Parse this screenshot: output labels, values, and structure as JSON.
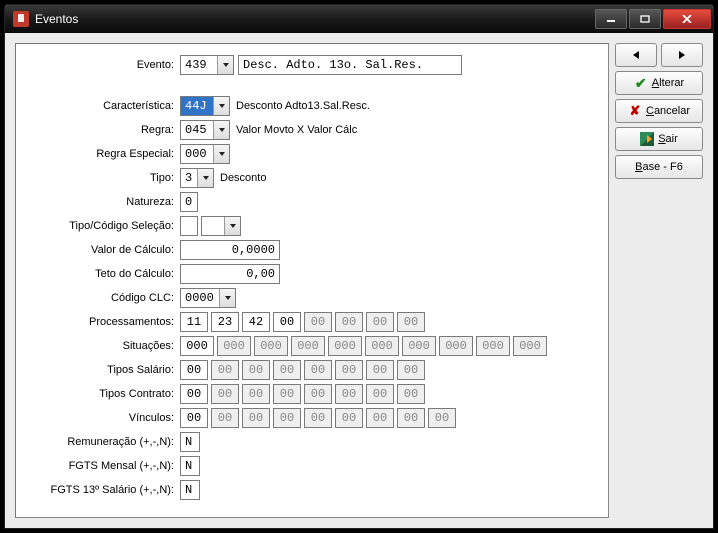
{
  "window": {
    "title": "Eventos"
  },
  "side": {
    "alterar": "Alterar",
    "cancelar": "Cancelar",
    "sair": "Sair",
    "base": "Base - F6"
  },
  "labels": {
    "evento": "Evento:",
    "caracteristica": "Característica:",
    "regra": "Regra:",
    "regra_especial": "Regra Especial:",
    "tipo": "Tipo:",
    "natureza": "Natureza:",
    "tipo_codigo_selecao": "Tipo/Código Seleção:",
    "valor_calculo": "Valor de Cálculo:",
    "teto_calculo": "Teto do Cálculo:",
    "codigo_clc": "Código CLC:",
    "processamentos": "Processamentos:",
    "situacoes": "Situações:",
    "tipos_salario": "Tipos Salário:",
    "tipos_contrato": "Tipos Contrato:",
    "vinculos": "Vínculos:",
    "remuneracao": "Remuneração (+,-,N):",
    "fgts_mensal": "FGTS Mensal (+,-,N):",
    "fgts_13": "FGTS 13º Salário (+,-,N):"
  },
  "fields": {
    "evento_code": "439",
    "evento_desc": "Desc. Adto. 13o. Sal.Res.",
    "caracteristica_code": "44J",
    "caracteristica_desc": "Desconto Adto13.Sal.Resc.",
    "regra_code": "045",
    "regra_desc": "Valor Movto X Valor Cálc",
    "regra_especial_code": "000",
    "tipo_code": "3",
    "tipo_desc": "Desconto",
    "natureza": "0",
    "tipo_sel": "",
    "codigo_sel": "",
    "valor_calculo": "0,0000",
    "teto_calculo": "0,00",
    "codigo_clc": "0000",
    "processamentos": [
      "11",
      "23",
      "42",
      "00",
      "00",
      "00",
      "00",
      "00"
    ],
    "proc_enabled": [
      true,
      true,
      true,
      true,
      false,
      false,
      false,
      false
    ],
    "situacoes": [
      "000",
      "000",
      "000",
      "000",
      "000",
      "000",
      "000",
      "000",
      "000",
      "000"
    ],
    "sit_enabled": [
      true,
      false,
      false,
      false,
      false,
      false,
      false,
      false,
      false,
      false
    ],
    "tipos_salario": [
      "00",
      "00",
      "00",
      "00",
      "00",
      "00",
      "00",
      "00"
    ],
    "tsal_enabled": [
      true,
      false,
      false,
      false,
      false,
      false,
      false,
      false
    ],
    "tipos_contrato": [
      "00",
      "00",
      "00",
      "00",
      "00",
      "00",
      "00",
      "00"
    ],
    "tcon_enabled": [
      true,
      false,
      false,
      false,
      false,
      false,
      false,
      false
    ],
    "vinculos": [
      "00",
      "00",
      "00",
      "00",
      "00",
      "00",
      "00",
      "00",
      "00"
    ],
    "vinc_enabled": [
      true,
      false,
      false,
      false,
      false,
      false,
      false,
      false,
      false
    ],
    "remuneracao": "N",
    "fgts_mensal": "N",
    "fgts_13": "N"
  }
}
